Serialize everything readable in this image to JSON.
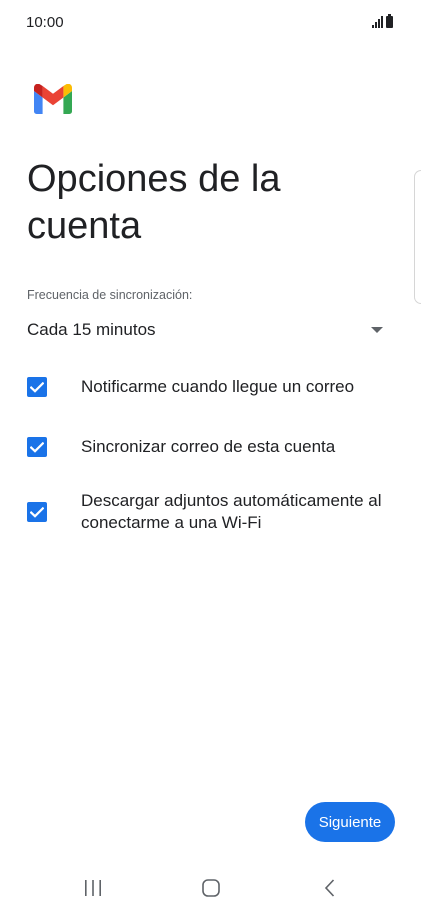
{
  "status_bar": {
    "time": "10:00",
    "icons": [
      "signal-icon",
      "battery-icon"
    ]
  },
  "app": {
    "logo_icon": "gmail-logo-icon"
  },
  "page": {
    "title": "Opciones de la cuenta"
  },
  "sync": {
    "label": "Frecuencia de sincronización:",
    "selected_value": "Cada 15 minutos"
  },
  "options": [
    {
      "label": "Notificarme cuando llegue un correo",
      "checked": true
    },
    {
      "label": "Sincronizar correo de esta cuenta",
      "checked": true
    },
    {
      "label": "Descargar adjuntos automáticamente al conectarme a una Wi-Fi",
      "checked": true
    }
  ],
  "actions": {
    "next_label": "Siguiente"
  },
  "navigation_bar": {
    "buttons": [
      "recents-icon",
      "home-icon",
      "back-icon"
    ]
  },
  "colors": {
    "accent": "#1a73e8",
    "text_primary": "#202124",
    "text_secondary": "#5f6368"
  }
}
